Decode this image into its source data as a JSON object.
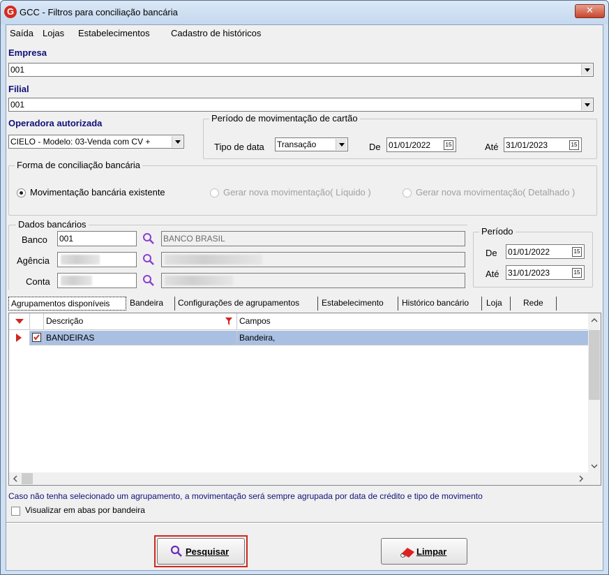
{
  "window": {
    "title": "GCC - Filtros para conciliação bancária",
    "icon_letter": "G",
    "close_glyph": "✕"
  },
  "menu": [
    "Saída",
    "Lojas",
    "Estabelecimentos",
    "Cadastro de históricos"
  ],
  "empresa": {
    "label": "Empresa",
    "value": "001"
  },
  "filial": {
    "label": "Filial",
    "value": "001"
  },
  "operadora": {
    "label": "Operadora autorizada",
    "value": "CIELO - Modelo: 03-Venda com CV +"
  },
  "periodo_cartao": {
    "title": "Período de movimentação de cartão",
    "tipo_label": "Tipo de data",
    "tipo_value": "Transação",
    "de_label": "De",
    "de_value": "01/01/2022",
    "ate_label": "Até",
    "ate_value": "31/01/2023",
    "cal_glyph": "15"
  },
  "forma": {
    "title": "Forma de conciliação bancária",
    "options": [
      "Movimentação bancária existente",
      "Gerar nova movimentação( Líquido )",
      "Gerar nova movimentação( Detalhado )"
    ],
    "selected": 0
  },
  "dados_bancarios": {
    "title": "Dados bancários",
    "banco_label": "Banco",
    "banco_value": "001",
    "banco_nome": "BANCO BRASIL",
    "agencia_label": "Agência",
    "conta_label": "Conta"
  },
  "periodo": {
    "title": "Período",
    "de_label": "De",
    "de_value": "01/01/2022",
    "ate_label": "Até",
    "ate_value": "31/01/2023"
  },
  "tabs": [
    "Agrupamentos disponíveis",
    "Bandeira",
    "Configurações de agrupamentos",
    "Estabelecimento",
    "Histórico bancário",
    "Loja",
    "Rede"
  ],
  "grid": {
    "columns": [
      "Descrição",
      "Campos"
    ],
    "rows": [
      {
        "descricao": "BANDEIRAS",
        "campos": "Bandeira,",
        "checked": true
      }
    ]
  },
  "info_text": "Caso não tenha selecionado um agrupamento,  a movimentação será sempre agrupada por data de crédito e tipo de movimento",
  "visualizar_label": "Visualizar em abas por bandeira",
  "buttons": {
    "pesquisar": "Pesquisar",
    "limpar": "Limpar"
  },
  "colors": {
    "label_blue": "#10107a",
    "row_highlight": "#aac0e3",
    "focus_red": "#d0271e",
    "accent_purple": "#8a3fd0"
  }
}
